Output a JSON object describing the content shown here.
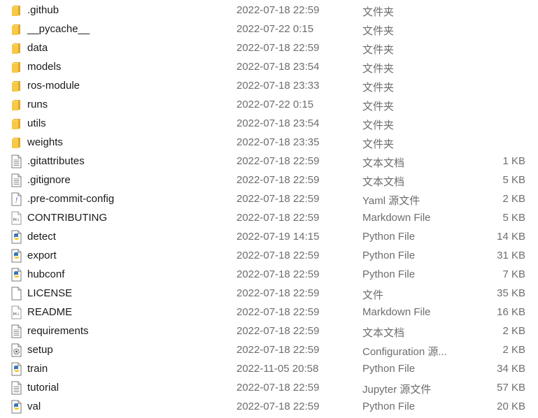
{
  "colors": {
    "folder": "#f7c948",
    "folder_dark": "#e0a92a",
    "text": "#1a1a1a",
    "meta_text": "#6d6d6d",
    "python_blue": "#3b77b6",
    "python_yellow": "#f5c518"
  },
  "files": [
    {
      "name": ".github",
      "date": "2022-07-18 22:59",
      "type": "文件夹",
      "size": "",
      "icon": "folder-icon"
    },
    {
      "name": "__pycache__",
      "date": "2022-07-22 0:15",
      "type": "文件夹",
      "size": "",
      "icon": "folder-icon"
    },
    {
      "name": "data",
      "date": "2022-07-18 22:59",
      "type": "文件夹",
      "size": "",
      "icon": "folder-icon"
    },
    {
      "name": "models",
      "date": "2022-07-18 23:54",
      "type": "文件夹",
      "size": "",
      "icon": "folder-icon"
    },
    {
      "name": "ros-module",
      "date": "2022-07-18 23:33",
      "type": "文件夹",
      "size": "",
      "icon": "folder-icon"
    },
    {
      "name": "runs",
      "date": "2022-07-22 0:15",
      "type": "文件夹",
      "size": "",
      "icon": "folder-icon"
    },
    {
      "name": "utils",
      "date": "2022-07-18 23:54",
      "type": "文件夹",
      "size": "",
      "icon": "folder-icon"
    },
    {
      "name": "weights",
      "date": "2022-07-18 23:35",
      "type": "文件夹",
      "size": "",
      "icon": "folder-icon"
    },
    {
      "name": ".gitattributes",
      "date": "2022-07-18 22:59",
      "type": "文本文档",
      "size": "1 KB",
      "icon": "text-file-icon"
    },
    {
      "name": ".gitignore",
      "date": "2022-07-18 22:59",
      "type": "文本文档",
      "size": "5 KB",
      "icon": "text-file-icon"
    },
    {
      "name": ".pre-commit-config",
      "date": "2022-07-18 22:59",
      "type": "Yaml 源文件",
      "size": "2 KB",
      "icon": "yaml-file-icon"
    },
    {
      "name": "CONTRIBUTING",
      "date": "2022-07-18 22:59",
      "type": "Markdown File",
      "size": "5 KB",
      "icon": "markdown-file-icon"
    },
    {
      "name": "detect",
      "date": "2022-07-19 14:15",
      "type": "Python File",
      "size": "14 KB",
      "icon": "python-file-icon"
    },
    {
      "name": "export",
      "date": "2022-07-18 22:59",
      "type": "Python File",
      "size": "31 KB",
      "icon": "python-file-icon"
    },
    {
      "name": "hubconf",
      "date": "2022-07-18 22:59",
      "type": "Python File",
      "size": "7 KB",
      "icon": "python-file-icon"
    },
    {
      "name": "LICENSE",
      "date": "2022-07-18 22:59",
      "type": "文件",
      "size": "35 KB",
      "icon": "blank-file-icon"
    },
    {
      "name": "README",
      "date": "2022-07-18 22:59",
      "type": "Markdown File",
      "size": "16 KB",
      "icon": "markdown-file-icon"
    },
    {
      "name": "requirements",
      "date": "2022-07-18 22:59",
      "type": "文本文档",
      "size": "2 KB",
      "icon": "text-file-icon"
    },
    {
      "name": "setup",
      "date": "2022-07-18 22:59",
      "type": "Configuration 源...",
      "size": "2 KB",
      "icon": "config-file-icon"
    },
    {
      "name": "train",
      "date": "2022-11-05 20:58",
      "type": "Python File",
      "size": "34 KB",
      "icon": "python-file-icon"
    },
    {
      "name": "tutorial",
      "date": "2022-07-18 22:59",
      "type": "Jupyter 源文件",
      "size": "57 KB",
      "icon": "text-file-icon"
    },
    {
      "name": "val",
      "date": "2022-07-18 22:59",
      "type": "Python File",
      "size": "20 KB",
      "icon": "python-file-icon"
    }
  ]
}
